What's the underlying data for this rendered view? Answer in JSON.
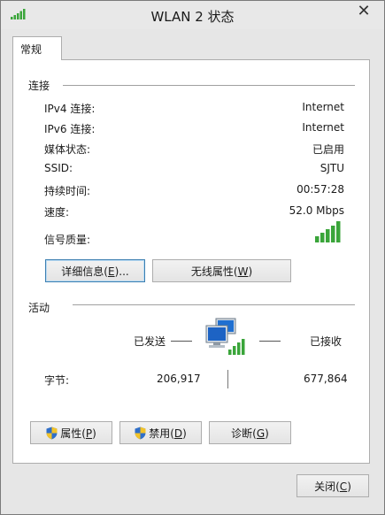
{
  "window": {
    "title": "WLAN 2 状态",
    "close_glyph": "✕"
  },
  "tab": {
    "label": "常规"
  },
  "connection": {
    "section_label": "连接",
    "rows": [
      {
        "label": "IPv4 连接:",
        "value": "Internet"
      },
      {
        "label": "IPv6 连接:",
        "value": "Internet"
      },
      {
        "label": "媒体状态:",
        "value": "已启用"
      },
      {
        "label": "SSID:",
        "value": "SJTU"
      },
      {
        "label": "持续时间:",
        "value": "00:57:28"
      },
      {
        "label": "速度:",
        "value": "52.0 Mbps"
      }
    ],
    "signal_label": "信号质量:",
    "signal_bars": 5,
    "details_button": {
      "text": "详细信息(",
      "mnemonic": "E",
      "suffix": ")..."
    },
    "wireless_button": {
      "text": "无线属性(",
      "mnemonic": "W",
      "suffix": ")"
    }
  },
  "activity": {
    "section_label": "活动",
    "sent_label": "已发送",
    "received_label": "已接收",
    "bytes_label": "字节:",
    "bytes_sent": "206,917",
    "bytes_received": "677,864"
  },
  "bottom_buttons": {
    "properties": {
      "text": "属性(",
      "mnemonic": "P",
      "suffix": ")"
    },
    "disable": {
      "text": "禁用(",
      "mnemonic": "D",
      "suffix": ")"
    },
    "diagnose": {
      "text": "诊断(",
      "mnemonic": "G",
      "suffix": ")"
    }
  },
  "close_button": {
    "text": "关闭(",
    "mnemonic": "C",
    "suffix": ")"
  },
  "colors": {
    "signal_green": "#3aa53a",
    "focus_border": "#3c7fb1"
  },
  "icons": [
    "signal-strength-icon",
    "network-computers-icon",
    "uac-shield-icon"
  ]
}
